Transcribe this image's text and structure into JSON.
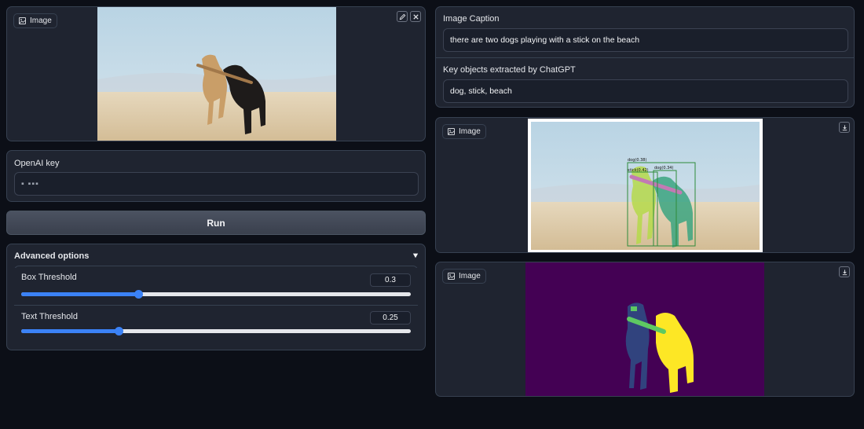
{
  "input_image": {
    "label": "Image",
    "edit_icon": "pencil-icon",
    "clear_icon": "close-icon"
  },
  "openai": {
    "label": "OpenAI key",
    "value": "▪ ▪▪▪"
  },
  "run_button": {
    "label": "Run"
  },
  "advanced": {
    "title": "Advanced options",
    "toggle_icon": "triangle-down-icon",
    "box_threshold": {
      "label": "Box Threshold",
      "value": "0.3",
      "fraction": 0.3
    },
    "text_threshold": {
      "label": "Text Threshold",
      "value": "0.25",
      "fraction": 0.25
    }
  },
  "caption": {
    "label": "Image Caption",
    "value": "there are two dogs playing with a stick on the beach"
  },
  "key_objects": {
    "label": "Key objects extracted by ChatGPT",
    "value": "dog, stick, beach"
  },
  "detection_image": {
    "label": "Image",
    "download_icon": "download-icon",
    "boxes": [
      {
        "label": "dog(0.38)"
      },
      {
        "label": "stick(0.42)"
      },
      {
        "label": "dog(0.34)"
      }
    ]
  },
  "mask_image": {
    "label": "Image",
    "download_icon": "download-icon"
  },
  "colors": {
    "background": "#0c0f17",
    "panel": "#1f2430",
    "accent": "#3b82f6",
    "mask_bg": "#440154",
    "mask_yellow": "#fde725",
    "mask_navy": "#31437e",
    "mask_green": "#5ec962"
  }
}
